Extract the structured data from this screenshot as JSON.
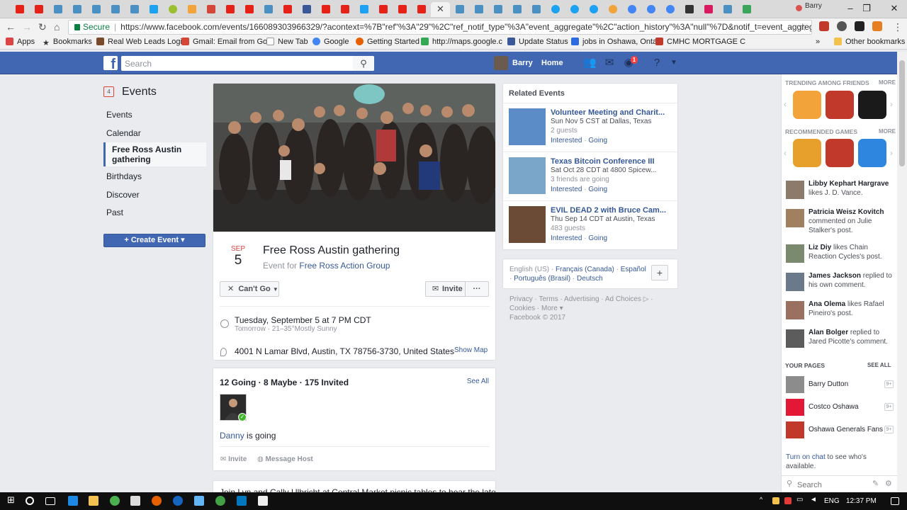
{
  "browser": {
    "profile_name": "Barry",
    "secure_label": "Secure",
    "url": "https://www.facebook.com/events/166089303966329/?acontext=%7B\"ref\"%3A\"29\"%2C\"ref_notif_type\"%3A\"event_aggregate\"%2C\"action_history\"%3A\"null\"%7D&notif_t=event_aggregate&not...",
    "bookmarks": [
      "Apps",
      "Bookmarks",
      "Real Web Leads Logi",
      "Gmail: Email from Go",
      "New Tab",
      "Google",
      "Getting Started",
      "http://maps.google.c",
      "Update Status",
      "jobs in Oshawa, Onta",
      "CMHC MORTGAGE C",
      "Other bookmarks"
    ],
    "bookmarks_overflow": "»"
  },
  "fb_header": {
    "logo": "f",
    "search_placeholder": "Search",
    "user_name": "Barry",
    "home_label": "Home",
    "notification_count": "1"
  },
  "left_nav": {
    "heading": "Events",
    "calendar_day": "4",
    "items": [
      "Events",
      "Calendar",
      "Free Ross Austin gathering",
      "Birthdays",
      "Discover",
      "Past"
    ],
    "create_button": "+ Create Event ▾"
  },
  "event": {
    "month": "SEP",
    "day": "5",
    "title": "Free Ross Austin gathering",
    "for_prefix": "Event for",
    "group": "Free Ross Action Group",
    "cant_go_label": "Can't Go",
    "invite_label": "Invite",
    "more_label": "···",
    "when": "Tuesday, September 5 at 7 PM CDT",
    "when_sub": "Tomorrow · 21–35°Mostly Sunny",
    "where": "4001 N Lamar Blvd, Austin, TX 78756-3730, United States",
    "show_map": "Show Map"
  },
  "going": {
    "summary": "12 Going · 8 Maybe · 175 Invited",
    "see_all": "See All",
    "person": "Danny",
    "is_going": "is going",
    "invite": "Invite",
    "message_host": "Message Host"
  },
  "description_preview": "Join Lyn and Cally Ulbricht at Central Market picnic tables to hear the latest",
  "related": {
    "title": "Related Events",
    "items": [
      {
        "name": "Volunteer Meeting and Charit...",
        "when": "Sun Nov 5 CST at Dallas, Texas",
        "guests": "2 guests",
        "interested": "Interested",
        "going": "Going",
        "color": "#5b8cc8"
      },
      {
        "name": "Texas Bitcoin Conference III",
        "when": "Sat Oct 28 CDT at 4800 Spicew...",
        "guests": "3 friends are going",
        "interested": "Interested",
        "going": "Going",
        "color": "#7aa6c9"
      },
      {
        "name": "EVIL DEAD 2 with Bruce Cam...",
        "when": "Thu Sep 14 CDT at Austin, Texas",
        "guests": "483 guests",
        "interested": "Interested",
        "going": "Going",
        "color": "#6b4a36"
      }
    ]
  },
  "languages": {
    "current": "English (US)",
    "others": [
      "Français (Canada)",
      "Español",
      "Português (Brasil)",
      "Deutsch"
    ],
    "add": "+"
  },
  "footer": {
    "links": "Privacy · Terms · Advertising · Ad Choices ▷ · Cookies · More ▾",
    "copyright": "Facebook © 2017"
  },
  "sidebar": {
    "trending_heading": "TRENDING AMONG FRIENDS",
    "more": "MORE",
    "recommended_heading": "RECOMMENDED GAMES",
    "trending_colors": [
      "#f2a33a",
      "#c0392b",
      "#1a1a1a"
    ],
    "recommended_colors": [
      "#e8a02c",
      "#c0392b",
      "#2e86de"
    ],
    "ticker": [
      {
        "name": "Libby Kephart Hargrave",
        "action": "likes J. D. Vance."
      },
      {
        "name": "Patricia Weisz Kovitch",
        "action": "commented on Julie Stalker's post."
      },
      {
        "name": "Liz Diy",
        "action": "likes Chain Reaction Cycles's post."
      },
      {
        "name": "James Jackson",
        "action": "replied to his own comment."
      },
      {
        "name": "Ana Olema",
        "action": "likes Rafael Pineiro's post."
      },
      {
        "name": "Alan Bolger",
        "action": "replied to Jared Picotte's comment."
      }
    ],
    "pages_heading": "YOUR PAGES",
    "see_all": "SEE ALL",
    "pages": [
      {
        "name": "Barry Dutton",
        "badge": "9+"
      },
      {
        "name": "Costco Oshawa",
        "badge": "9+"
      },
      {
        "name": "Oshawa Generals Fans",
        "badge": "9+"
      }
    ],
    "chat_link": "Turn on chat",
    "chat_suffix": " to see who's available.",
    "chat_search_placeholder": "Search"
  },
  "taskbar": {
    "lang": "ENG",
    "time": "12:37 PM"
  }
}
